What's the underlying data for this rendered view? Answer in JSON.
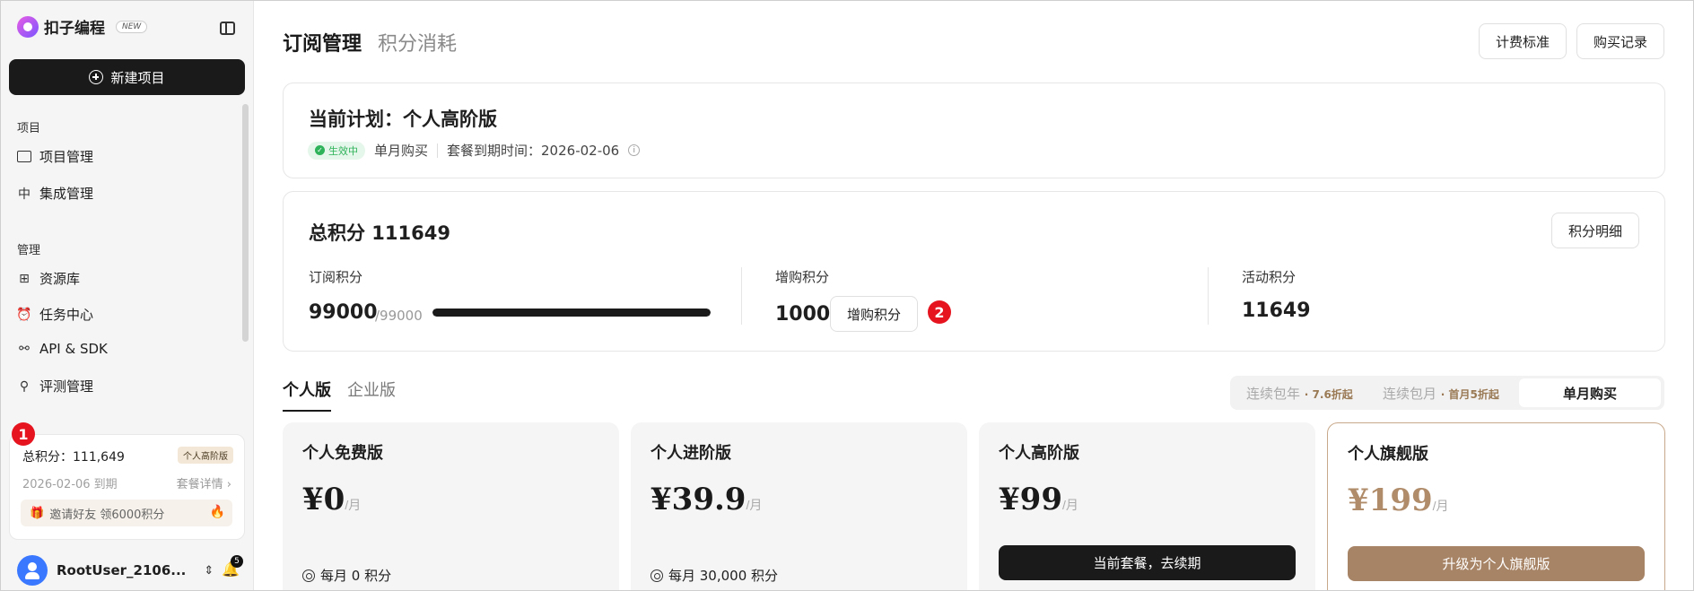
{
  "sidebar": {
    "brand": "扣子编程",
    "brand_badge": "NEW",
    "new_project": "新建项目",
    "section_project": "项目",
    "section_manage": "管理",
    "items": [
      {
        "label": "项目管理",
        "icon": "folder-icon"
      },
      {
        "label": "集成管理",
        "icon": "integration-icon"
      },
      {
        "label": "资源库",
        "icon": "resource-icon"
      },
      {
        "label": "任务中心",
        "icon": "alarm-icon"
      },
      {
        "label": "API & SDK",
        "icon": "api-icon"
      },
      {
        "label": "评测管理",
        "icon": "telescope-icon"
      }
    ],
    "credits_card": {
      "total": "总积分：111,649",
      "plan_tag": "个人高阶版",
      "expire": "2026-02-06 到期",
      "detail_link": "套餐详情",
      "invite": "邀请好友 领6000积分"
    },
    "step_badge": "1",
    "user": {
      "name": "RootUser_2106...",
      "notifications": "5"
    }
  },
  "header": {
    "tabs": [
      "订阅管理",
      "积分消耗"
    ],
    "buttons": [
      "计费标准",
      "购买记录"
    ]
  },
  "current_plan": {
    "title": "当前计划：个人高阶版",
    "status": "生效中",
    "purchase_type": "单月购买",
    "expire_label": "套餐到期时间：2026-02-06"
  },
  "credits": {
    "title": "总积分  111649",
    "detail_button": "积分明细",
    "subscription": {
      "label": "订阅积分",
      "value": "99000",
      "max": "/99000",
      "progress": 1.0
    },
    "addon": {
      "label": "增购积分",
      "value": "1000",
      "button": "增购积分"
    },
    "activity": {
      "label": "活动积分",
      "value": "11649"
    },
    "step_badge": "2"
  },
  "plan_tabs": [
    "个人版",
    "企业版"
  ],
  "billing": {
    "yearly": "连续包年",
    "yearly_discount": "· 7.6折起",
    "monthly_cont": "连续包月",
    "monthly_discount": "· 首月5折起",
    "single": "单月购买"
  },
  "plans": [
    {
      "name": "个人免费版",
      "price": "¥0",
      "unit": "/月",
      "monthly_credits": "每月 0 积分"
    },
    {
      "name": "个人进阶版",
      "price": "¥39.9",
      "unit": "/月",
      "monthly_credits": "每月 30,000 积分"
    },
    {
      "name": "个人高阶版",
      "price": "¥99",
      "unit": "/月",
      "button": "当前套餐，去续期"
    },
    {
      "name": "个人旗舰版",
      "price": "¥199",
      "unit": "/月",
      "button": "升级为个人旗舰版"
    }
  ],
  "colors": {
    "accent_gold": "#a88466",
    "active_green": "#2eb35a",
    "badge_red": "#e5141e"
  }
}
